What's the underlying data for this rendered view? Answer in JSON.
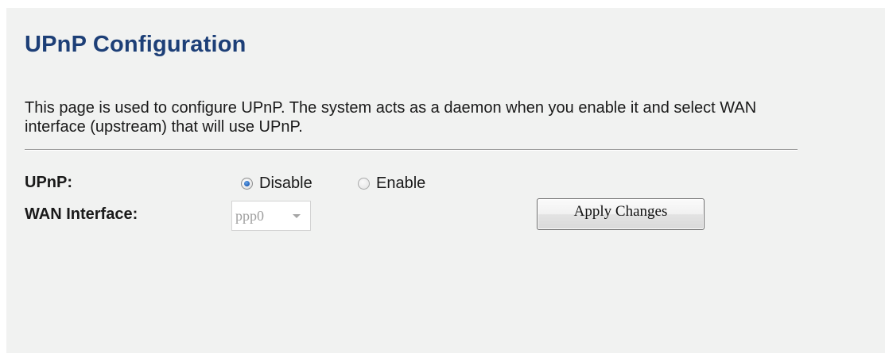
{
  "page": {
    "title": "UPnP Configuration",
    "description": "This page is used to configure UPnP. The system acts as a daemon when you enable it and select WAN interface (upstream) that will use UPnP."
  },
  "form": {
    "upnp_label": "UPnP:",
    "upnp_options": [
      {
        "label": "Disable",
        "checked": true
      },
      {
        "label": "Enable",
        "checked": false
      }
    ],
    "wan_label": "WAN Interface:",
    "wan_interface": {
      "selected": "ppp0",
      "disabled": true
    },
    "apply_label": "Apply Changes"
  },
  "colors": {
    "title": "#1d3f77",
    "panel_background": "#f1f2f1",
    "radio_checked": "#1f5fb8"
  }
}
